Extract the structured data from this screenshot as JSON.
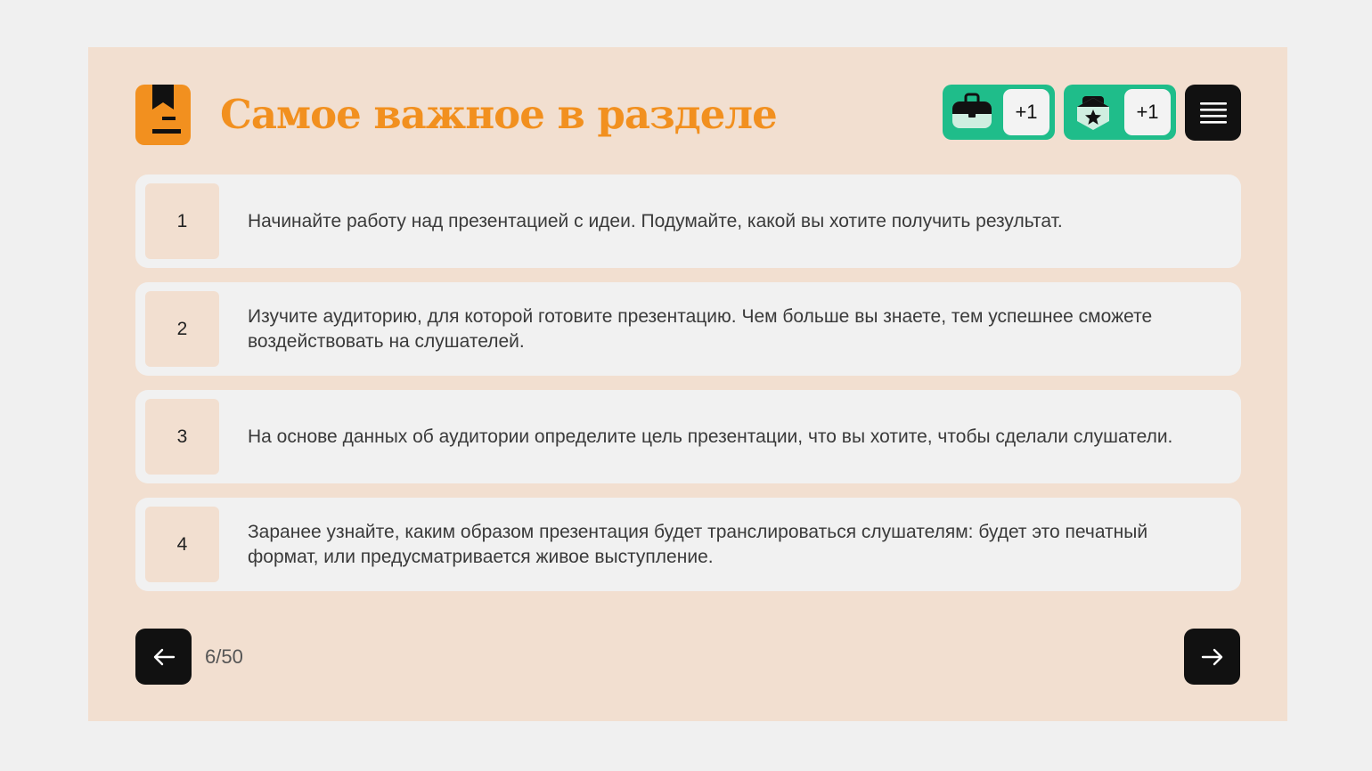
{
  "header": {
    "icon": "bookmark-document-icon",
    "title": "Самое важное в разделе"
  },
  "badges": [
    {
      "icon": "briefcase-icon",
      "count": "+1"
    },
    {
      "icon": "shield-star-icon",
      "count": "+1"
    }
  ],
  "menu": {
    "icon": "hamburger-menu-icon"
  },
  "items": [
    {
      "number": "1",
      "text": "Начинайте работу над презентацией с идеи. Подумайте, какой вы хотите получить результат."
    },
    {
      "number": "2",
      "text": "Изучите аудиторию, для которой готовите презентацию. Чем больше вы знаете, тем успешнее сможете воздействовать на слушателей."
    },
    {
      "number": "3",
      "text": "На основе данных об аудитории определите цель презентации, что вы хотите, чтобы сделали слушатели."
    },
    {
      "number": "4",
      "text": "Заранее узнайте, каким образом презентация будет транслироваться слушателям: будет это печатный формат, или предусматривается живое выступление."
    }
  ],
  "pagination": {
    "counter": "6/50",
    "prev_icon": "arrow-left-icon",
    "next_icon": "arrow-right-icon"
  },
  "colors": {
    "accent": "#f2901f",
    "card_background": "#f2dfd0",
    "badge_green": "#1fbd8a",
    "dark": "#111111"
  }
}
